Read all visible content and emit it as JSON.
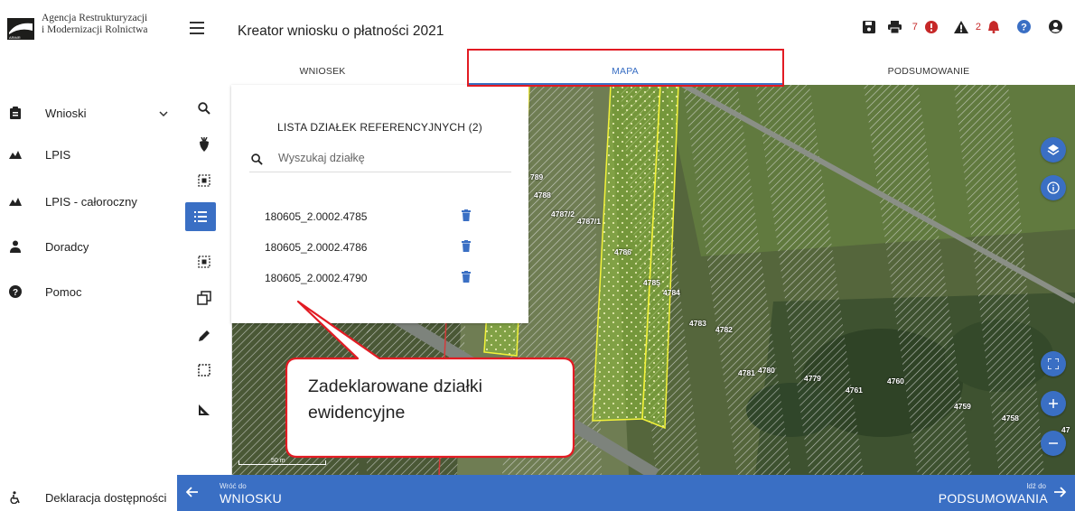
{
  "logo": {
    "line1": "Agencja Restrukturyzacji",
    "line2": "i Modernizacji Rolnictwa",
    "badge": "ARiMR"
  },
  "sidebar": {
    "items": [
      {
        "label": "Wnioski",
        "icon": "clipboard-icon"
      },
      {
        "label": "LPIS",
        "icon": "mountain-icon"
      },
      {
        "label": "LPIS - całoroczny",
        "icon": "mountain-icon"
      },
      {
        "label": "Doradcy",
        "icon": "person-icon"
      },
      {
        "label": "Pomoc",
        "icon": "help-icon"
      }
    ],
    "footer": "Deklaracja dostępności"
  },
  "header": {
    "title": "Kreator wniosku o płatności 2021",
    "print_count": "7",
    "warning_count": "2"
  },
  "tabs": [
    {
      "label": "WNIOSEK"
    },
    {
      "label": "MAPA"
    },
    {
      "label": "PODSUMOWANIE"
    }
  ],
  "panel": {
    "title": "LISTA DZIAŁEK REFERENCYJNYCH (2)",
    "search_placeholder": "Wyszukaj działkę",
    "plots": [
      {
        "id": "180605_2.0002.4785"
      },
      {
        "id": "180605_2.0002.4786"
      },
      {
        "id": "180605_2.0002.4790"
      }
    ]
  },
  "map": {
    "plot_numbers": [
      "789",
      "4788",
      "4787/2",
      "4787/1",
      "4786",
      "4785",
      "4784",
      "4783",
      "4782",
      "4781",
      "4780",
      "4779",
      "4761",
      "4760",
      "4759",
      "4758",
      "47"
    ],
    "scale": "50 m"
  },
  "callout": {
    "line1": "Zadeklarowane działki",
    "line2": "ewidencyjne"
  },
  "bottom": {
    "back_small": "Wróć do",
    "back_big": "WNIOSKU",
    "next_small": "Idź do",
    "next_big": "PODSUMOWANIA"
  },
  "colors": {
    "accent": "#3a6fc4",
    "highlight": "#e21b23",
    "alert": "#c62828"
  }
}
